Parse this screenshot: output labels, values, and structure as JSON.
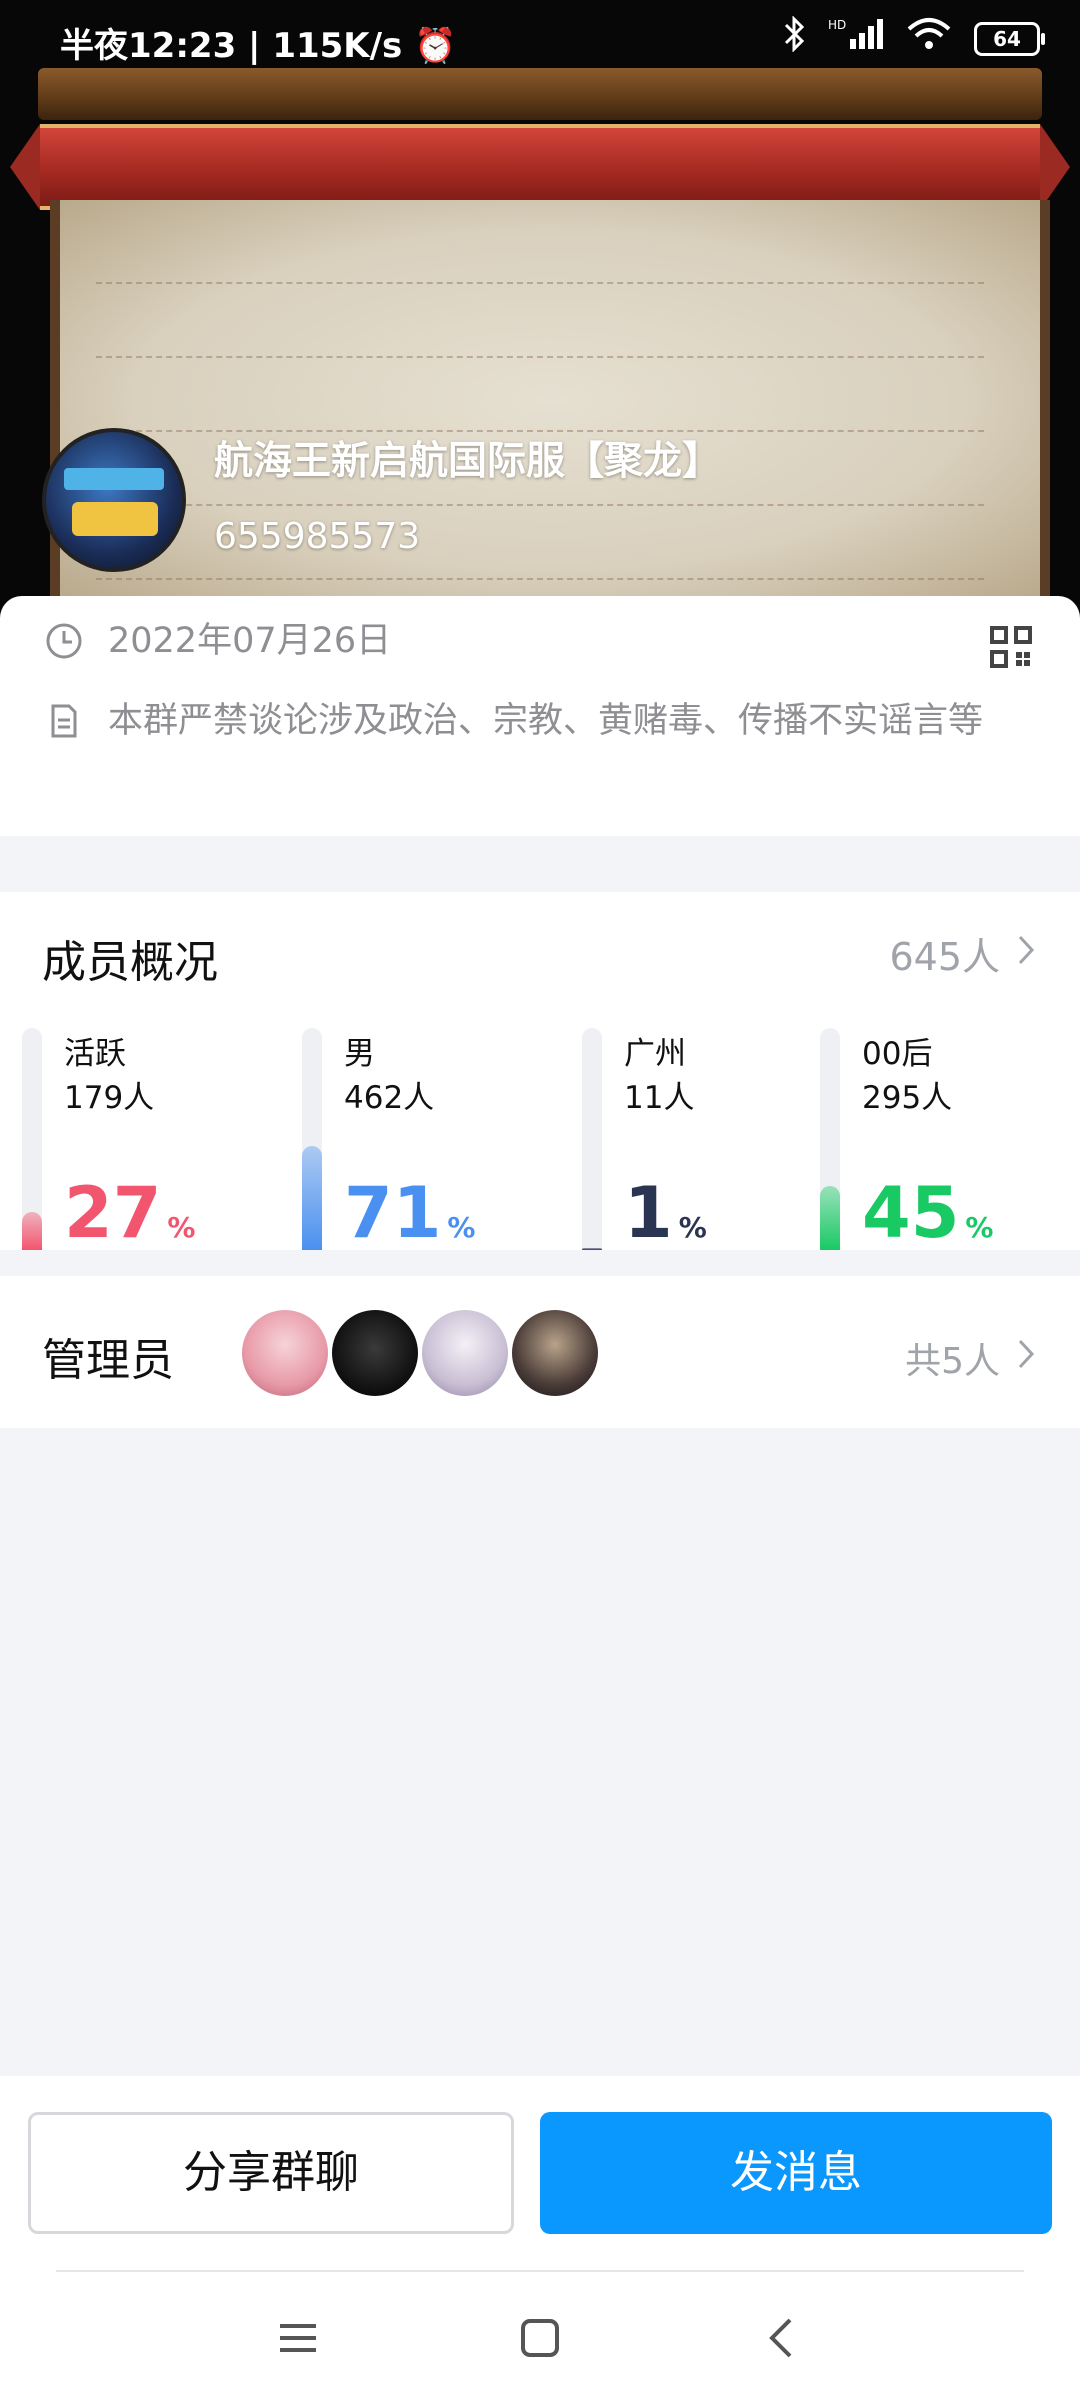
{
  "status_bar": {
    "time_speed": "半夜12:23 | 115K/s",
    "icons": [
      "alarm-icon",
      "bluetooth-icon",
      "hd-signal-icon",
      "wifi-icon",
      "battery-icon"
    ],
    "battery": "64"
  },
  "group": {
    "name": "航海王新启航国际服【聚龙】",
    "id": "655985573",
    "date": "2022年07月26日",
    "notice": "本群严禁谈论涉及政治、宗教、黄赌毒、传播不实谣言等"
  },
  "members": {
    "title": "成员概况",
    "total": "645人",
    "stats": [
      {
        "label": "活跃",
        "count": "179人",
        "percent": "27",
        "unit": "%",
        "fill": 0.17,
        "color": "#f2556e"
      },
      {
        "label": "男",
        "count": "462人",
        "percent": "71",
        "unit": "%",
        "fill": 0.47,
        "color": "#4a90f0"
      },
      {
        "label": "广州",
        "count": "11人",
        "percent": "1",
        "unit": "%",
        "fill": 0.01,
        "color": "#2a3552"
      },
      {
        "label": "00后",
        "count": "295人",
        "percent": "45",
        "unit": "%",
        "fill": 0.29,
        "color": "#19c964"
      }
    ]
  },
  "admins": {
    "title": "管理员",
    "total": "共5人"
  },
  "actions": {
    "share": "分享群聊",
    "send": "发消息"
  },
  "colors": {
    "accent": "#0a98ff",
    "secondary_text": "#8e8e93"
  }
}
